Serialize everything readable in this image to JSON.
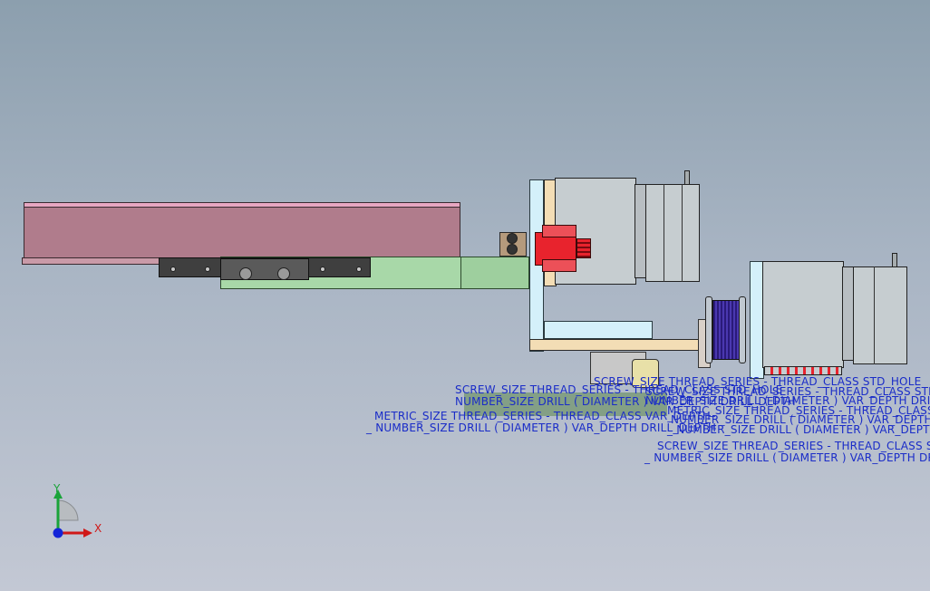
{
  "viewport": {
    "name": "cad-graphics-area",
    "background_top": "#8c9fae",
    "background_bottom": "#c3c8d4"
  },
  "colors": {
    "callout_text": "#1a2cc8",
    "rail": "#b07c8c",
    "slider": "#a8d8a8",
    "bracket": "#f3ddb5",
    "plate": "#d4f0fa",
    "motor": "#c6cdd0",
    "connector": "#e8232d",
    "pulley": "#2a1a7a"
  },
  "triad": {
    "y_label": "Y",
    "x_label": "X",
    "y_color": "#1aa33a",
    "x_color": "#d01818",
    "z_color": "#1424d8"
  },
  "hole_callouts": [
    {
      "id": "callout-1",
      "text": "SCREW_SIZE THREAD_SERIES - THREAD_CLASS STD_HOLE"
    },
    {
      "id": "callout-2",
      "text": "NUMBER_SIZE DRILL ( DIAMETER ) VAR_DEPTH DRILL_DEPTH"
    },
    {
      "id": "callout-3",
      "text": "METRIC_SIZE THREAD_SERIES - THREAD_CLASS VAR_DEPTH"
    },
    {
      "id": "callout-4",
      "text": "_ NUMBER_SIZE DRILL ( DIAMETER ) VAR_DEPTH DRILL_DEPTH"
    },
    {
      "id": "callout-5",
      "text": "SCREW_SIZE THREAD_SERIES - THREAD_CLASS STD_HOLE"
    },
    {
      "id": "callout-6",
      "text": "SCREW_SIZE THREAD_SERIES - THREAD_CLASS STD_HOLE"
    },
    {
      "id": "callout-7",
      "text": "NUMBER_SIZE DRILL ( DIAMETER ) VAR_DEPTH DRILL_DEPTH"
    },
    {
      "id": "callout-8",
      "text": "METRIC_SIZE THREAD_SERIES - THREAD_CLASS VAR_DEPTH"
    },
    {
      "id": "callout-9",
      "text": "NUMBER_SIZE DRILL ( DIAMETER ) VAR_DEPTH DRILL_DEPTH"
    },
    {
      "id": "callout-10",
      "text": "_ NUMBER_SIZE DRILL ( DIAMETER ) VAR_DEPTH DRILL_DEPTH"
    },
    {
      "id": "callout-11",
      "text": "SCREW_SIZE THREAD_SERIES - THREAD_CLASS STD_HOLE"
    },
    {
      "id": "callout-12",
      "text": "_ NUMBER_SIZE DRILL ( DIAMETER ) VAR_DEPTH DRILL_DEPTH"
    }
  ]
}
